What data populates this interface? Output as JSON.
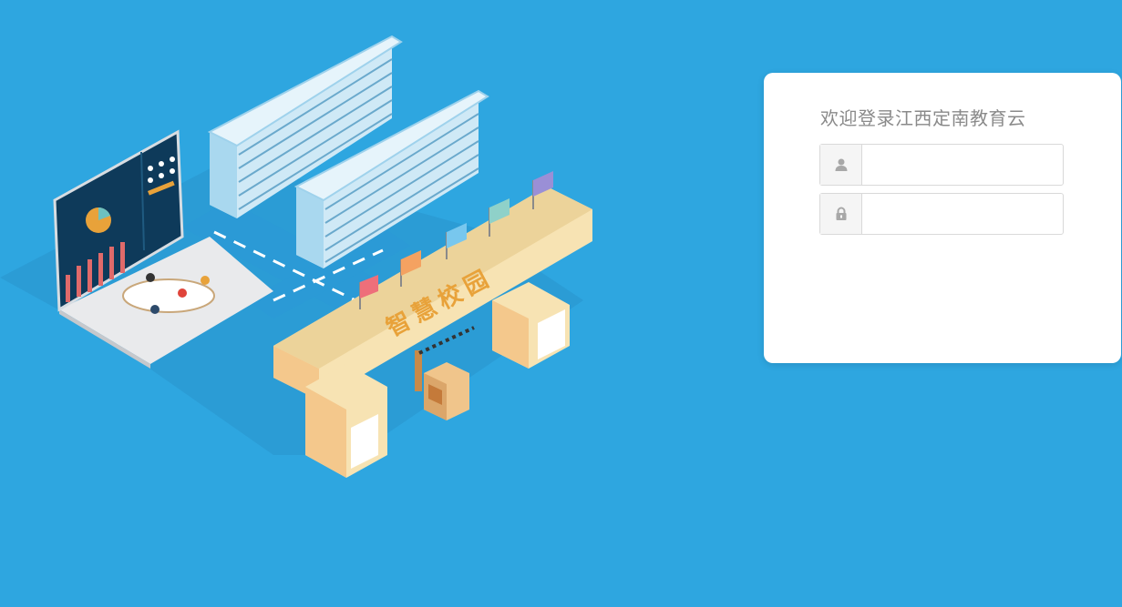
{
  "login": {
    "title": "欢迎登录江西定南教育云",
    "username": {
      "value": "",
      "placeholder": ""
    },
    "password": {
      "value": "",
      "placeholder": ""
    }
  },
  "illustration": {
    "gate_sign": "智慧校园"
  },
  "icons": {
    "username": "user-icon",
    "password": "lock-icon"
  },
  "colors": {
    "background": "#2ea6e0",
    "card": "#ffffff",
    "title_text": "#8a8a8a",
    "gate_sign": "#e8a23a"
  }
}
